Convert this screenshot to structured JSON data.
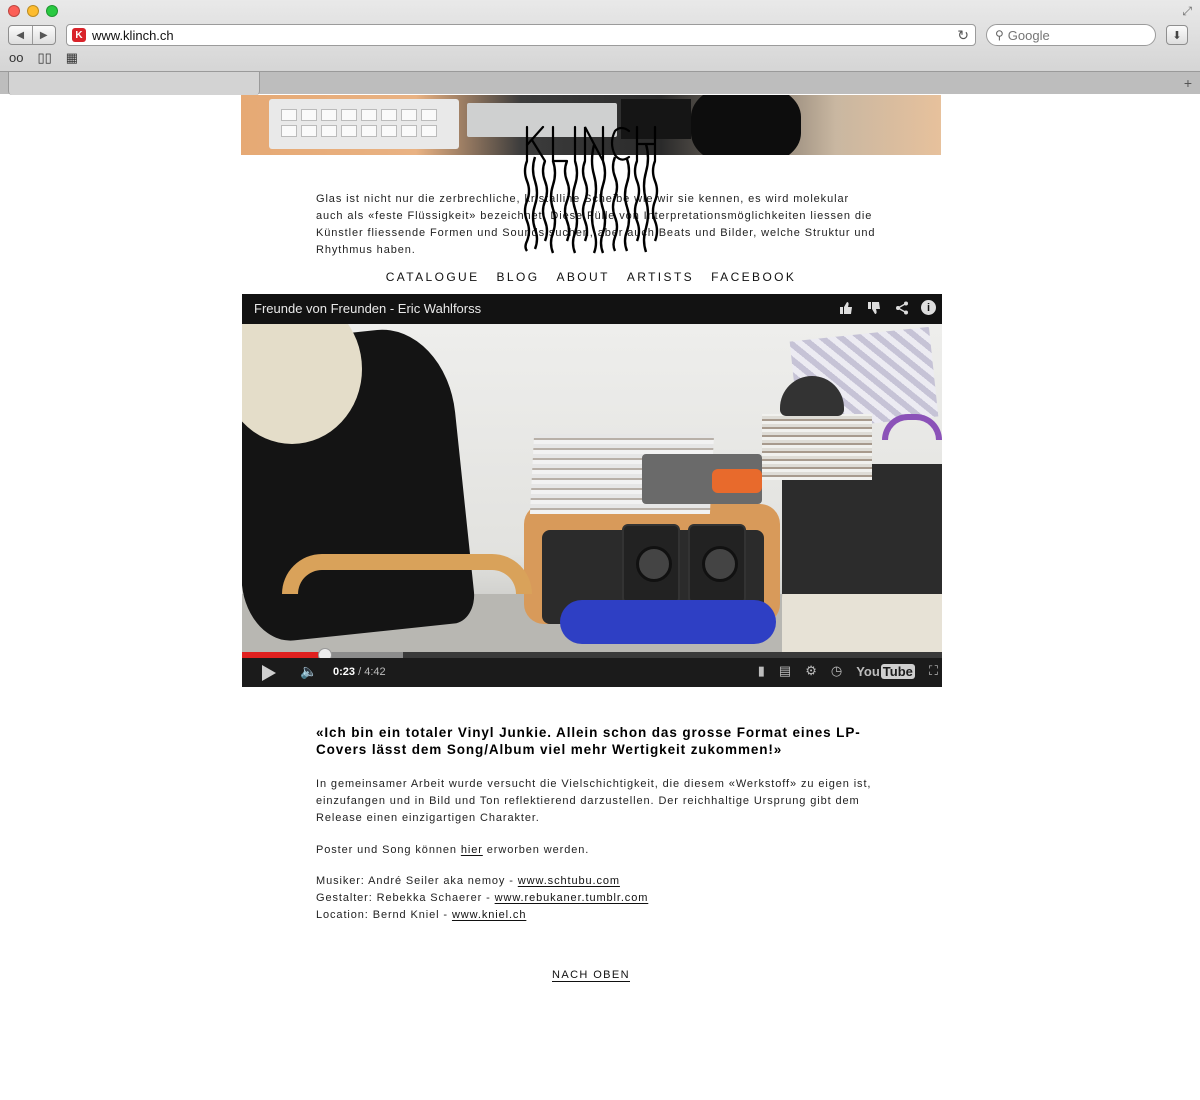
{
  "browser": {
    "url": "www.klinch.ch",
    "search_placeholder": "Google",
    "back_glyph": "◀",
    "forward_glyph": "▶",
    "reload_glyph": "↻",
    "download_glyph": "⬇",
    "newtab_glyph": "+",
    "favicon_letter": "K",
    "reading_list_glyph": "oo",
    "bookmarks_glyph": "▯▯",
    "topsites_glyph": "▦"
  },
  "logo": {
    "text": "KLINCH"
  },
  "intro_text": "Glas ist nicht nur die zerbrechliche, kristalline Scheibe wie wir sie kennen, es wird molekular auch als «feste Flüssigkeit» bezeichnet. Diese Fülle von Interpretationsmöglichkeiten liessen die Künstler fliessende Formen und Sounds suchen, aber auch Beats und Bilder, welche Struktur und Rhythmus haben.",
  "nav": {
    "catalogue": "CATALOGUE",
    "blog": "BLOG",
    "about": "ABOUT",
    "artists": "ARTISTS",
    "facebook": "FACEBOOK"
  },
  "video": {
    "title": "Freunde von Freunden - Eric Wahlforss",
    "current_time": "0:23",
    "separator": " / ",
    "duration": "4:42",
    "played_fraction": 0.118,
    "buffered_fraction": 0.23,
    "progress_color": "#e0201f",
    "brand": "You",
    "brand_box": "Tube",
    "info_glyph": "i"
  },
  "article": {
    "quote": "«Ich bin ein totaler Vinyl Junkie. Allein schon das grosse Format eines LP-Covers lässt dem Song/Album viel mehr Wertigkeit zukommen!»",
    "body": "In gemeinsamer Arbeit wurde versucht die Vielschichtigkeit, die diesem «Werkstoff» zu eigen ist, einzufangen und in Bild und Ton reflektierend darzustellen. Der reichhaltige Ursprung gibt dem Release einen einzigartigen Charakter.",
    "purchase_before": "Poster und Song können ",
    "purchase_link": "hier",
    "purchase_after": " erworben werden.",
    "credits": [
      {
        "label": "Musiker: André Seiler aka nemoy - ",
        "link": "www.schtubu.com"
      },
      {
        "label": "Gestalter: Rebekka Schaerer - ",
        "link": "www.rebukaner.tumblr.com"
      },
      {
        "label": "Location: Bernd Kniel - ",
        "link": "www.kniel.ch"
      }
    ]
  },
  "back_to_top": "NACH OBEN"
}
